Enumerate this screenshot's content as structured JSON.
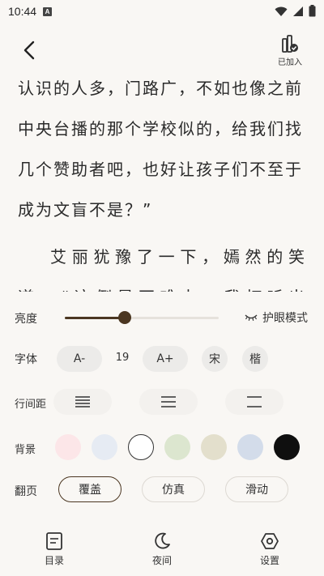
{
  "status_bar": {
    "time": "10:44",
    "notification_badge": "A"
  },
  "top_bar": {
    "shelf_label": "已加入"
  },
  "content": {
    "para1": "认识的人多，门路广，不如也像之前中央台播的那个学校似的，给我们找几个赞助者吧，也好让孩子们不至于成为文盲不是？”",
    "para2": "艾丽犹豫了一下，嫣然的笑道，“这倒是不难办，我打听出来的"
  },
  "settings": {
    "brightness": {
      "label": "亮度",
      "level_percent": 39,
      "eye_mode_label": "护眼模式"
    },
    "font": {
      "label": "字体",
      "decrease": "A-",
      "size": "19",
      "increase": "A+",
      "song": "宋",
      "kai": "楷"
    },
    "line_spacing": {
      "label": "行间距",
      "options": [
        "tight",
        "medium",
        "loose"
      ]
    },
    "background": {
      "label": "背景",
      "colors": [
        "#fce6e8",
        "#e6ebf3",
        "#ffffff",
        "#dce6cf",
        "#e3dfcc",
        "#d3dcea",
        "#0f0f0f"
      ],
      "selected_index": 2
    },
    "page_turn": {
      "label": "翻页",
      "options": [
        "覆盖",
        "仿真",
        "滑动"
      ],
      "selected_index": 0
    }
  },
  "bottom_nav": {
    "toc": "目录",
    "night": "夜间",
    "settings": "设置"
  },
  "colors": {
    "accent": "#4b3621",
    "page_bg": "#f9f7f4",
    "pill_bg": "#ecebe9"
  }
}
